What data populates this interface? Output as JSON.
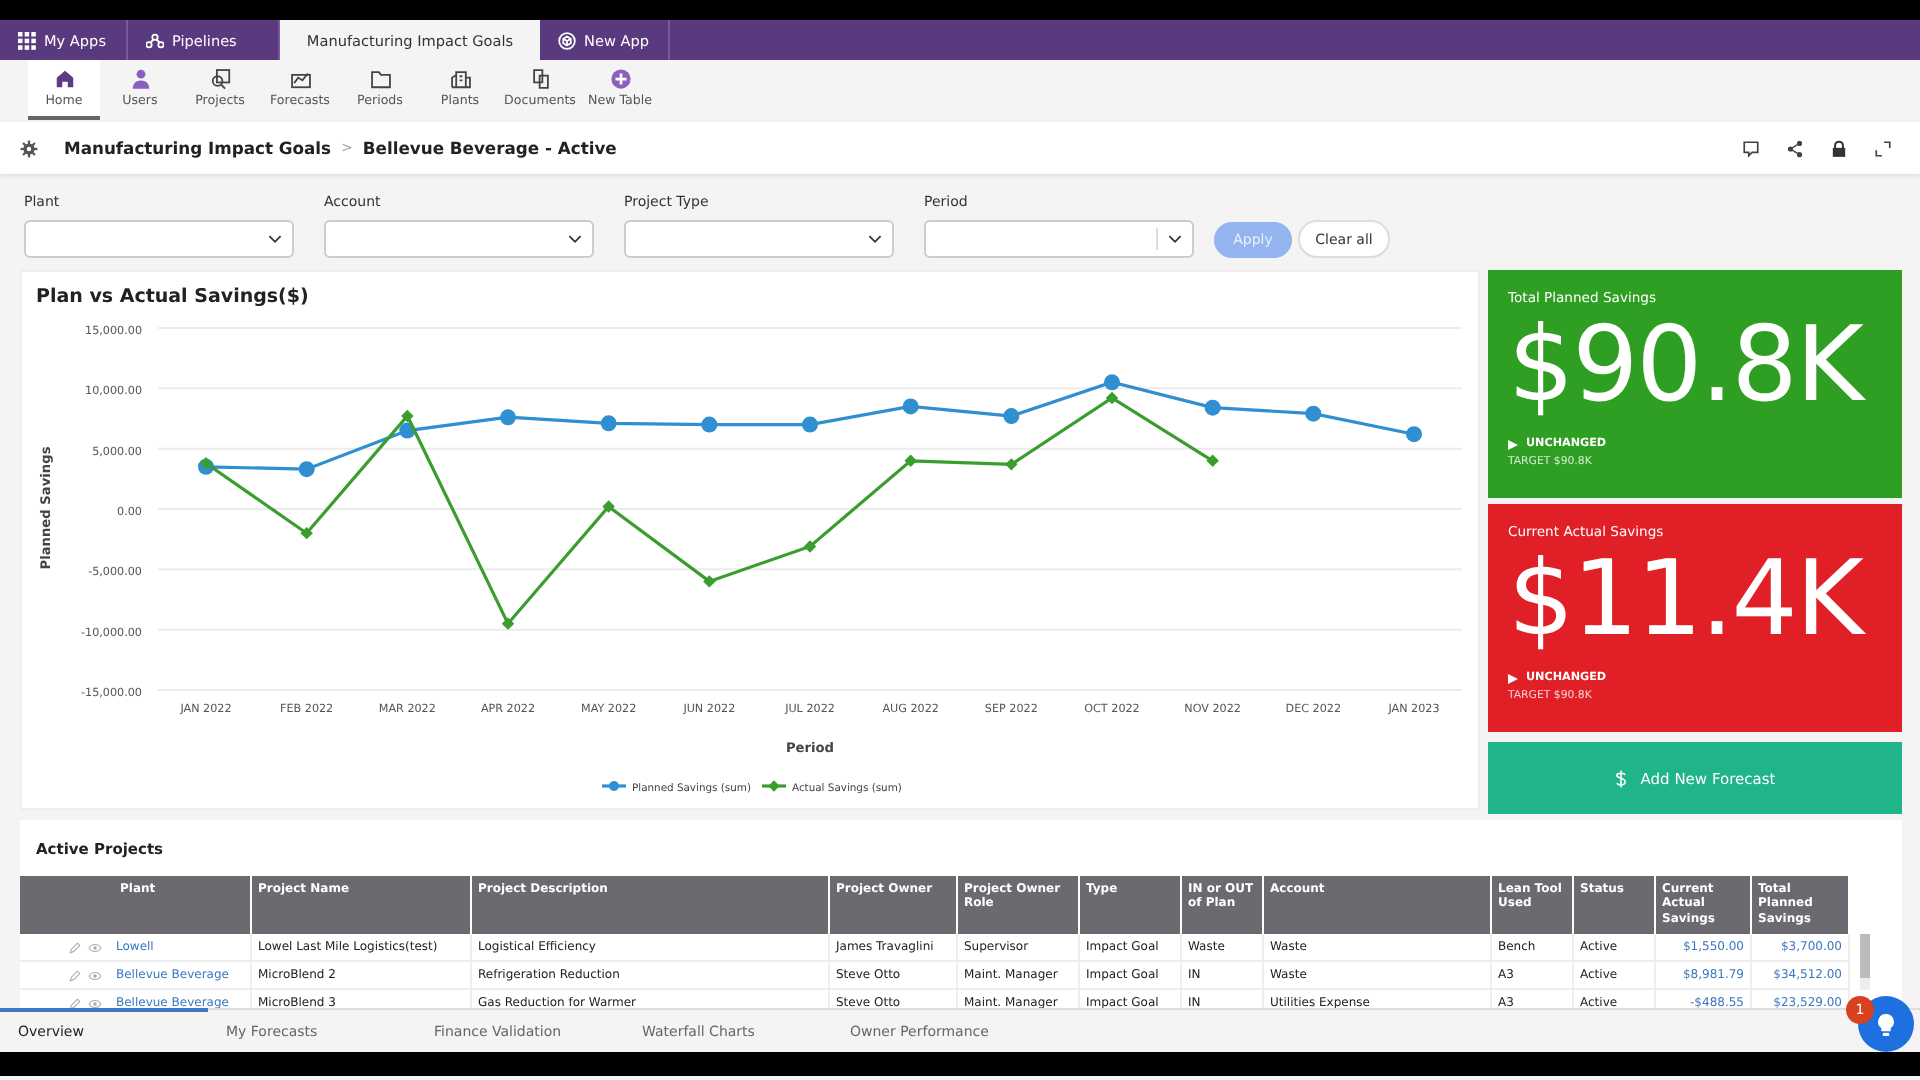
{
  "app_tabs": [
    {
      "label": "My Apps",
      "kind": "grid",
      "selected": false
    },
    {
      "label": "Pipelines",
      "kind": "nodes",
      "selected": false
    },
    {
      "label": "Manufacturing Impact Goals",
      "kind": "none",
      "selected": true
    },
    {
      "label": "New App",
      "kind": "cube",
      "selected": false
    }
  ],
  "toolbar": [
    {
      "label": "Home",
      "kind": "home",
      "selected": true
    },
    {
      "label": "Users",
      "kind": "user",
      "selected": false
    },
    {
      "label": "Projects",
      "kind": "projects",
      "selected": false
    },
    {
      "label": "Forecasts",
      "kind": "forecast",
      "selected": false
    },
    {
      "label": "Periods",
      "kind": "folder",
      "selected": false
    },
    {
      "label": "Plants",
      "kind": "plant",
      "selected": false
    },
    {
      "label": "Documents",
      "kind": "docs",
      "selected": false
    },
    {
      "label": "New Table",
      "kind": "plus",
      "selected": false
    }
  ],
  "breadcrumb": {
    "parent": "Manufacturing Impact Goals",
    "separator": ">",
    "current": "Bellevue Beverage - Active"
  },
  "filters": [
    {
      "label": "Plant"
    },
    {
      "label": "Account"
    },
    {
      "label": "Project Type"
    },
    {
      "label": "Period"
    }
  ],
  "apply_button": {
    "label": "Apply",
    "disabled": true
  },
  "clear_button": {
    "label": "Clear all"
  },
  "chart": {
    "title": "Plan vs Actual Savings($)",
    "chart_data": {
      "type": "line",
      "xlabel": "Period",
      "ylabel": "Planned Savings",
      "categories": [
        "JAN 2022",
        "FEB 2022",
        "MAR 2022",
        "APR 2022",
        "MAY 2022",
        "JUN 2022",
        "JUL 2022",
        "AUG 2022",
        "SEP 2022",
        "OCT 2022",
        "NOV 2022",
        "DEC 2022",
        "JAN 2023"
      ],
      "series": [
        {
          "name": "Planned Savings (sum)",
          "color": "#2f8fd0",
          "marker": "circle",
          "values": [
            3500,
            3300,
            6500,
            7600,
            7100,
            7000,
            7000,
            8500,
            7700,
            10500,
            8400,
            7900,
            6200
          ]
        },
        {
          "name": "Actual Savings (sum)",
          "color": "#3a9d2e",
          "marker": "diamond",
          "values": [
            3800,
            -2000,
            7700,
            -9500,
            200,
            -6000,
            -3100,
            4000,
            3700,
            9200,
            4000,
            null,
            null
          ]
        }
      ],
      "ylim": [
        -15000,
        15000
      ],
      "grid": true,
      "legend": true,
      "yticks": [
        {
          "value": 15000,
          "label": "15,000.00"
        },
        {
          "value": 10000,
          "label": "10,000.00"
        },
        {
          "value": 5000,
          "label": "5,000.00"
        },
        {
          "value": 0,
          "label": "0.00"
        },
        {
          "value": -5000,
          "label": "-5,000.00"
        },
        {
          "value": -10000,
          "label": "-10,000.00"
        },
        {
          "value": -15000,
          "label": "-15,000.00"
        }
      ]
    }
  },
  "kpis": [
    {
      "title": "Total Planned Savings",
      "value": "$90.8K",
      "trend": "UNCHANGED",
      "target": "TARGET $90.8K",
      "color": "#2e9f22"
    },
    {
      "title": "Current Actual Savings",
      "value": "$11.4K",
      "trend": "UNCHANGED",
      "target": "TARGET $90.8K",
      "color": "#e01f27"
    }
  ],
  "add_forecast_button": {
    "label": "Add New Forecast"
  },
  "projects": {
    "title": "Active Projects",
    "columns": [
      "Plant",
      "Project Name",
      "Project Description",
      "Project Owner",
      "Project Owner Role",
      "Type",
      "IN or OUT of Plan",
      "Account",
      "Lean Tool Used",
      "Status",
      "Current Actual Savings",
      "Total Planned Savings"
    ],
    "rows": [
      {
        "cells": [
          "Lowell",
          "Lowel Last Mile Logistics(test)",
          "Logistical Efficiency",
          "James Travaglini",
          "Supervisor",
          "Impact Goal",
          "Waste",
          "Waste",
          "Bench",
          "Active",
          "$1,550.00",
          "$3,700.00"
        ]
      },
      {
        "cells": [
          "Bellevue Beverage",
          "MicroBlend 2",
          "Refrigeration Reduction",
          "Steve Otto",
          "Maint. Manager",
          "Impact Goal",
          "IN",
          "Waste",
          "A3",
          "Active",
          "$8,981.79",
          "$34,512.00"
        ]
      },
      {
        "cells": [
          "Bellevue Beverage",
          "MicroBlend 3",
          "Gas Reduction for Warmer",
          "Steve Otto",
          "Maint. Manager",
          "Impact Goal",
          "IN",
          "Utilities Expense",
          "A3",
          "Active",
          "-$488.55",
          "$23,529.00"
        ]
      }
    ]
  },
  "bottom_tabs": [
    {
      "label": "Overview",
      "selected": true
    },
    {
      "label": "My Forecasts",
      "selected": false
    },
    {
      "label": "Finance Validation",
      "selected": false
    },
    {
      "label": "Waterfall Charts",
      "selected": false
    },
    {
      "label": "Owner Performance",
      "selected": false
    }
  ],
  "help_badge": "1"
}
